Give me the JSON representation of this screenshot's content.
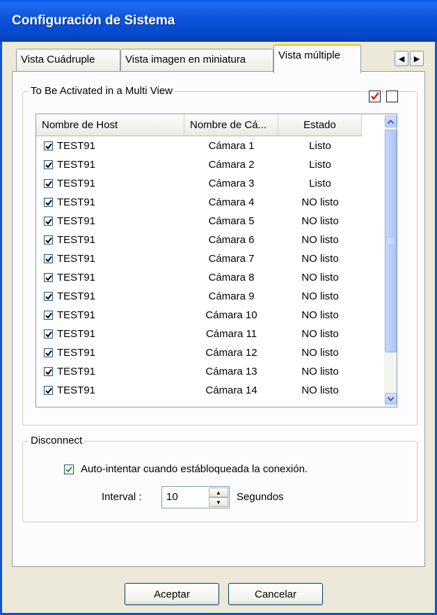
{
  "window": {
    "title": "Configuración de Sistema"
  },
  "tabs": [
    {
      "label": "Vista Cuádruple",
      "active": false
    },
    {
      "label": "Vista imagen en miniatura",
      "active": false
    },
    {
      "label": "Vista múltiple",
      "active": true
    }
  ],
  "tab_scroll": {
    "left_icon": "arrow-left-icon",
    "right_icon": "arrow-right-icon"
  },
  "multi_view_group": {
    "legend": "To Be Activated in a Multi View",
    "check_all_icon": "check-all-icon",
    "uncheck_all_icon": "uncheck-all-icon"
  },
  "host_list": {
    "columns": [
      "Nombre de Host",
      "Nombre de Cá...",
      "Estado"
    ],
    "rows": [
      {
        "checked": true,
        "host": "TEST91",
        "camera": "Cámara 1",
        "status": "Listo"
      },
      {
        "checked": true,
        "host": "TEST91",
        "camera": "Cámara 2",
        "status": "Listo"
      },
      {
        "checked": true,
        "host": "TEST91",
        "camera": "Cámara 3",
        "status": "Listo"
      },
      {
        "checked": true,
        "host": "TEST91",
        "camera": "Cámara 4",
        "status": "NO listo"
      },
      {
        "checked": true,
        "host": "TEST91",
        "camera": "Cámara 5",
        "status": "NO listo"
      },
      {
        "checked": true,
        "host": "TEST91",
        "camera": "Cámara 6",
        "status": "NO listo"
      },
      {
        "checked": true,
        "host": "TEST91",
        "camera": "Cámara 7",
        "status": "NO listo"
      },
      {
        "checked": true,
        "host": "TEST91",
        "camera": "Cámara 8",
        "status": "NO listo"
      },
      {
        "checked": true,
        "host": "TEST91",
        "camera": "Cámara 9",
        "status": "NO listo"
      },
      {
        "checked": true,
        "host": "TEST91",
        "camera": "Cámara 10",
        "status": "NO listo"
      },
      {
        "checked": true,
        "host": "TEST91",
        "camera": "Cámara 11",
        "status": "NO listo"
      },
      {
        "checked": true,
        "host": "TEST91",
        "camera": "Cámara 12",
        "status": "NO listo"
      },
      {
        "checked": true,
        "host": "TEST91",
        "camera": "Cámara 13",
        "status": "NO listo"
      },
      {
        "checked": true,
        "host": "TEST91",
        "camera": "Cámara 14",
        "status": "NO listo"
      }
    ]
  },
  "disconnect_group": {
    "legend": "Disconnect",
    "auto_retry_checked": true,
    "auto_retry_label": "Auto-intentar cuando estábloqueada la conexión.",
    "interval_label": "Interval :",
    "interval_value": "10",
    "interval_unit": "Segundos"
  },
  "footer": {
    "ok_label": "Aceptar",
    "cancel_label": "Cancelar"
  }
}
